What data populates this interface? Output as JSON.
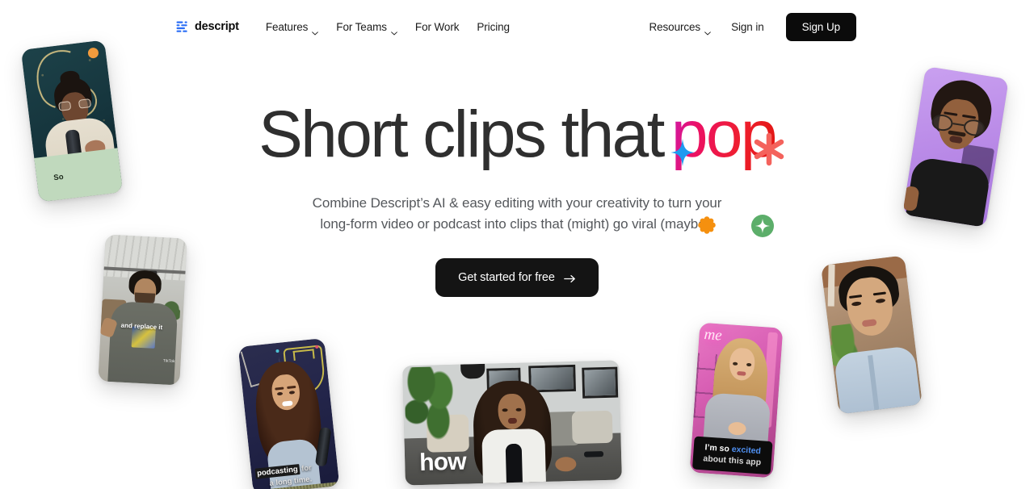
{
  "brand": {
    "name": "descript",
    "logo_icon": "descript-waveform-logo",
    "logo_color": "#2b6ef5"
  },
  "nav": {
    "left_items": [
      {
        "label": "Features",
        "has_dropdown": true
      },
      {
        "label": "For Teams",
        "has_dropdown": true
      },
      {
        "label": "For Work",
        "has_dropdown": false
      },
      {
        "label": "Pricing",
        "has_dropdown": false
      }
    ],
    "right_items": [
      {
        "label": "Resources",
        "has_dropdown": true
      }
    ],
    "sign_in_label": "Sign in",
    "sign_up_label": "Sign Up",
    "sign_up_bg": "#0b0b0b"
  },
  "hero": {
    "headline_plain": "Short clips that",
    "headline_accent": "pop",
    "accent_gradient_from": "#c41cc0",
    "accent_gradient_to": "#e01510",
    "subheadline_line1": "Combine Descript’s AI & easy editing with your creativity to turn your",
    "subheadline_line2": "long-form video or podcast into clips that (might) go viral (maybe).",
    "cta_label": "Get started for free",
    "cta_arrow_icon": "arrow-right-icon",
    "decorations": [
      {
        "name": "blue-four-point-star-icon",
        "color": "#1e9af0"
      },
      {
        "name": "red-asterisk-icon",
        "color": "#f4625c"
      },
      {
        "name": "orange-flower-burst-icon",
        "color": "#f5900f"
      },
      {
        "name": "green-circle-sparkle-icon",
        "color": "#5cae6a"
      }
    ]
  },
  "cards": [
    {
      "id": "mic",
      "name": "card-podcaster-microphone",
      "caption": "So",
      "caption_bg": "#c0d9bd",
      "badge_color": "#f19b3d",
      "alt": "Person with glasses speaking into a microphone, dark teal neon background"
    },
    {
      "id": "studio",
      "name": "card-studio-guy",
      "caption": "and replace it",
      "watermark": "TikTok",
      "alt": "Man in grey t-shirt standing in a studio loft"
    },
    {
      "id": "podcast",
      "name": "card-podcasting-woman",
      "caption_highlight": "podcasting",
      "caption_rest": " for",
      "caption_line2": "a long time.",
      "alt": "Woman with long brown hair speaking into a microphone"
    },
    {
      "id": "how",
      "name": "card-how-living-room",
      "caption": "how",
      "alt": "Woman with curly hair on a sofa speaking into a microphone"
    },
    {
      "id": "excited",
      "name": "card-excited-pink",
      "caption_line1_plain": "I’m so ",
      "caption_line1_accent": "excited",
      "caption_line2": "about this app",
      "accent_color": "#4f8ff0",
      "caption_bg": "#0c0c0c",
      "neon_sign": "me",
      "alt": "Blonde woman in grey sweater with pink neon background"
    },
    {
      "id": "purple",
      "name": "card-purple-bg-man",
      "alt": "Man with glasses and black shirt on a lavender background"
    },
    {
      "id": "outdoor",
      "name": "card-outdoor-woman",
      "alt": "Woman in light blue shirt outdoors near plants"
    }
  ]
}
